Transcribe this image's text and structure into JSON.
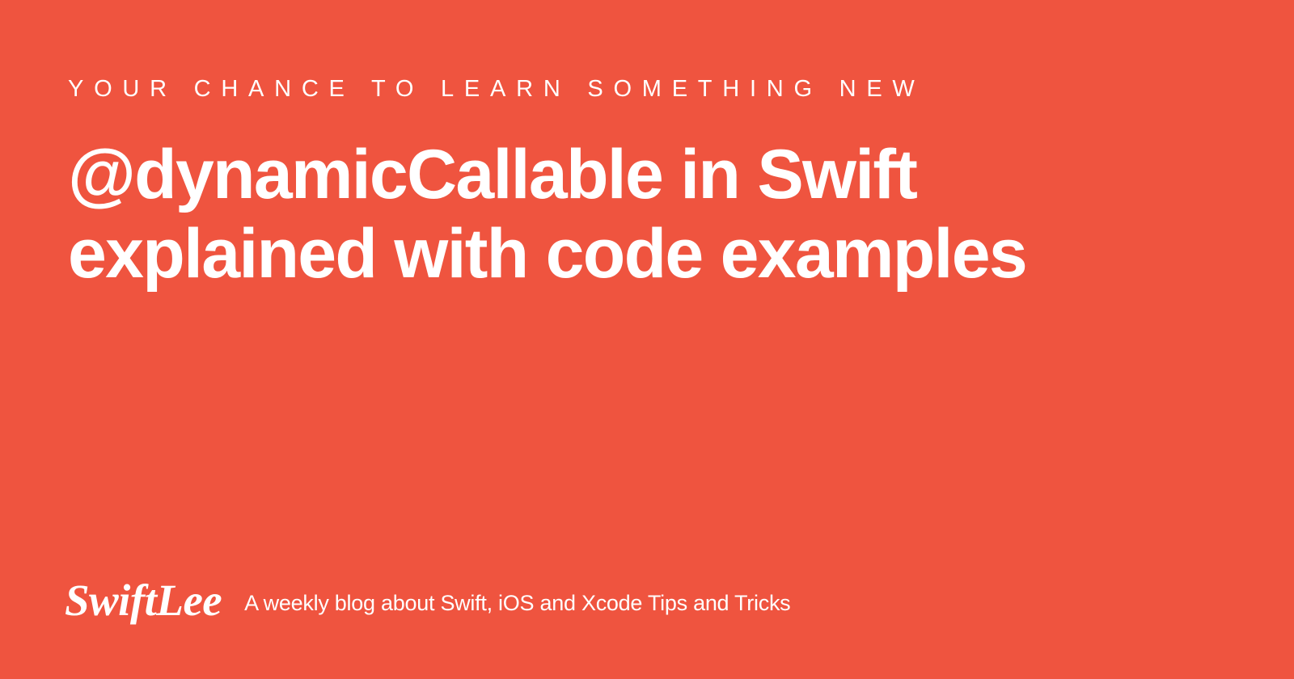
{
  "eyebrow": "YOUR CHANCE TO LEARN SOMETHING NEW",
  "headline": "@dynamicCallable in Swift explained with code examples",
  "footer": {
    "logo": "SwiftLee",
    "tagline": "A weekly blog about Swift, iOS and Xcode Tips and Tricks"
  },
  "colors": {
    "background": "#ef543f",
    "text": "#ffffff"
  }
}
